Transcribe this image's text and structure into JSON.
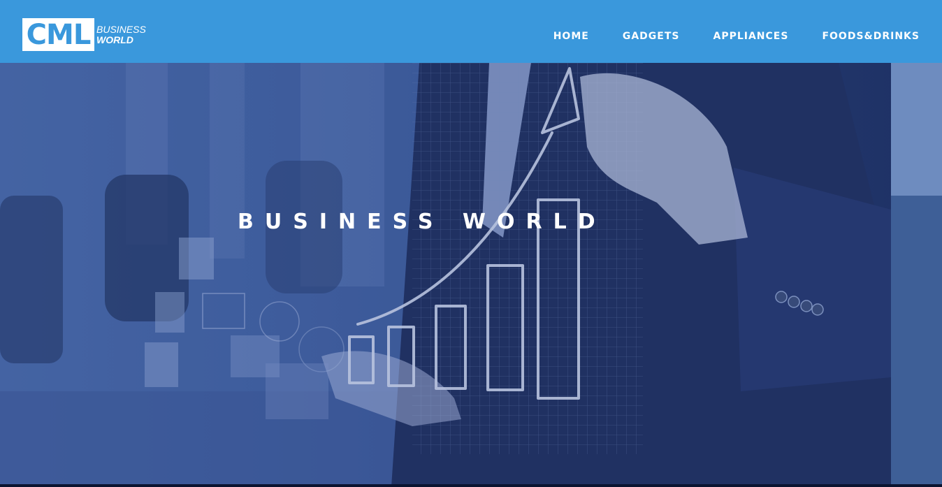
{
  "brand": {
    "logo_mark": "CML",
    "logo_line1": "BUSINESS",
    "logo_line2": "WORLD"
  },
  "nav": {
    "items": [
      {
        "label": "HOME"
      },
      {
        "label": "GADGETS"
      },
      {
        "label": "APPLIANCES"
      },
      {
        "label": "FOODS&DRINKS"
      }
    ]
  },
  "hero": {
    "title": "BUSINESS WORLD"
  },
  "colors": {
    "header": "#3a98dc",
    "hero_overlay": "#2c4a8f",
    "text": "#ffffff"
  }
}
